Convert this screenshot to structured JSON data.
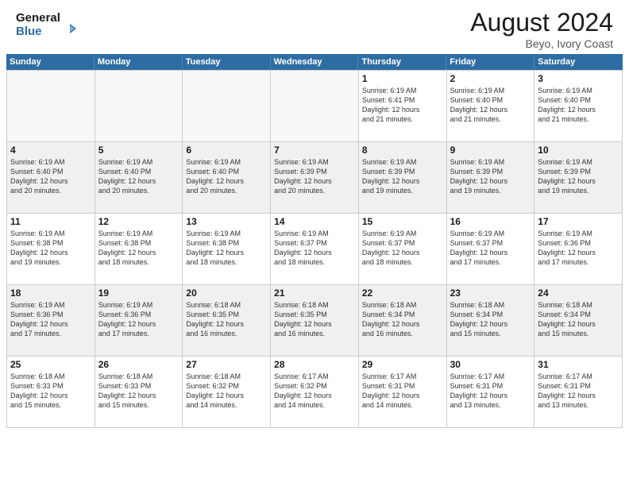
{
  "header": {
    "logo_line1": "General",
    "logo_line2": "Blue",
    "month_title": "August 2024",
    "location": "Beyo, Ivory Coast"
  },
  "days_of_week": [
    "Sunday",
    "Monday",
    "Tuesday",
    "Wednesday",
    "Thursday",
    "Friday",
    "Saturday"
  ],
  "weeks": [
    {
      "shaded": false,
      "cells": [
        {
          "day": "",
          "empty": true,
          "lines": []
        },
        {
          "day": "",
          "empty": true,
          "lines": []
        },
        {
          "day": "",
          "empty": true,
          "lines": []
        },
        {
          "day": "",
          "empty": true,
          "lines": []
        },
        {
          "day": "1",
          "empty": false,
          "lines": [
            "Sunrise: 6:19 AM",
            "Sunset: 6:41 PM",
            "Daylight: 12 hours",
            "and 21 minutes."
          ]
        },
        {
          "day": "2",
          "empty": false,
          "lines": [
            "Sunrise: 6:19 AM",
            "Sunset: 6:40 PM",
            "Daylight: 12 hours",
            "and 21 minutes."
          ]
        },
        {
          "day": "3",
          "empty": false,
          "lines": [
            "Sunrise: 6:19 AM",
            "Sunset: 6:40 PM",
            "Daylight: 12 hours",
            "and 21 minutes."
          ]
        }
      ]
    },
    {
      "shaded": true,
      "cells": [
        {
          "day": "4",
          "empty": false,
          "lines": [
            "Sunrise: 6:19 AM",
            "Sunset: 6:40 PM",
            "Daylight: 12 hours",
            "and 20 minutes."
          ]
        },
        {
          "day": "5",
          "empty": false,
          "lines": [
            "Sunrise: 6:19 AM",
            "Sunset: 6:40 PM",
            "Daylight: 12 hours",
            "and 20 minutes."
          ]
        },
        {
          "day": "6",
          "empty": false,
          "lines": [
            "Sunrise: 6:19 AM",
            "Sunset: 6:40 PM",
            "Daylight: 12 hours",
            "and 20 minutes."
          ]
        },
        {
          "day": "7",
          "empty": false,
          "lines": [
            "Sunrise: 6:19 AM",
            "Sunset: 6:39 PM",
            "Daylight: 12 hours",
            "and 20 minutes."
          ]
        },
        {
          "day": "8",
          "empty": false,
          "lines": [
            "Sunrise: 6:19 AM",
            "Sunset: 6:39 PM",
            "Daylight: 12 hours",
            "and 19 minutes."
          ]
        },
        {
          "day": "9",
          "empty": false,
          "lines": [
            "Sunrise: 6:19 AM",
            "Sunset: 6:39 PM",
            "Daylight: 12 hours",
            "and 19 minutes."
          ]
        },
        {
          "day": "10",
          "empty": false,
          "lines": [
            "Sunrise: 6:19 AM",
            "Sunset: 6:39 PM",
            "Daylight: 12 hours",
            "and 19 minutes."
          ]
        }
      ]
    },
    {
      "shaded": false,
      "cells": [
        {
          "day": "11",
          "empty": false,
          "lines": [
            "Sunrise: 6:19 AM",
            "Sunset: 6:38 PM",
            "Daylight: 12 hours",
            "and 19 minutes."
          ]
        },
        {
          "day": "12",
          "empty": false,
          "lines": [
            "Sunrise: 6:19 AM",
            "Sunset: 6:38 PM",
            "Daylight: 12 hours",
            "and 18 minutes."
          ]
        },
        {
          "day": "13",
          "empty": false,
          "lines": [
            "Sunrise: 6:19 AM",
            "Sunset: 6:38 PM",
            "Daylight: 12 hours",
            "and 18 minutes."
          ]
        },
        {
          "day": "14",
          "empty": false,
          "lines": [
            "Sunrise: 6:19 AM",
            "Sunset: 6:37 PM",
            "Daylight: 12 hours",
            "and 18 minutes."
          ]
        },
        {
          "day": "15",
          "empty": false,
          "lines": [
            "Sunrise: 6:19 AM",
            "Sunset: 6:37 PM",
            "Daylight: 12 hours",
            "and 18 minutes."
          ]
        },
        {
          "day": "16",
          "empty": false,
          "lines": [
            "Sunrise: 6:19 AM",
            "Sunset: 6:37 PM",
            "Daylight: 12 hours",
            "and 17 minutes."
          ]
        },
        {
          "day": "17",
          "empty": false,
          "lines": [
            "Sunrise: 6:19 AM",
            "Sunset: 6:36 PM",
            "Daylight: 12 hours",
            "and 17 minutes."
          ]
        }
      ]
    },
    {
      "shaded": true,
      "cells": [
        {
          "day": "18",
          "empty": false,
          "lines": [
            "Sunrise: 6:19 AM",
            "Sunset: 6:36 PM",
            "Daylight: 12 hours",
            "and 17 minutes."
          ]
        },
        {
          "day": "19",
          "empty": false,
          "lines": [
            "Sunrise: 6:19 AM",
            "Sunset: 6:36 PM",
            "Daylight: 12 hours",
            "and 17 minutes."
          ]
        },
        {
          "day": "20",
          "empty": false,
          "lines": [
            "Sunrise: 6:18 AM",
            "Sunset: 6:35 PM",
            "Daylight: 12 hours",
            "and 16 minutes."
          ]
        },
        {
          "day": "21",
          "empty": false,
          "lines": [
            "Sunrise: 6:18 AM",
            "Sunset: 6:35 PM",
            "Daylight: 12 hours",
            "and 16 minutes."
          ]
        },
        {
          "day": "22",
          "empty": false,
          "lines": [
            "Sunrise: 6:18 AM",
            "Sunset: 6:34 PM",
            "Daylight: 12 hours",
            "and 16 minutes."
          ]
        },
        {
          "day": "23",
          "empty": false,
          "lines": [
            "Sunrise: 6:18 AM",
            "Sunset: 6:34 PM",
            "Daylight: 12 hours",
            "and 15 minutes."
          ]
        },
        {
          "day": "24",
          "empty": false,
          "lines": [
            "Sunrise: 6:18 AM",
            "Sunset: 6:34 PM",
            "Daylight: 12 hours",
            "and 15 minutes."
          ]
        }
      ]
    },
    {
      "shaded": false,
      "cells": [
        {
          "day": "25",
          "empty": false,
          "lines": [
            "Sunrise: 6:18 AM",
            "Sunset: 6:33 PM",
            "Daylight: 12 hours",
            "and 15 minutes."
          ]
        },
        {
          "day": "26",
          "empty": false,
          "lines": [
            "Sunrise: 6:18 AM",
            "Sunset: 6:33 PM",
            "Daylight: 12 hours",
            "and 15 minutes."
          ]
        },
        {
          "day": "27",
          "empty": false,
          "lines": [
            "Sunrise: 6:18 AM",
            "Sunset: 6:32 PM",
            "Daylight: 12 hours",
            "and 14 minutes."
          ]
        },
        {
          "day": "28",
          "empty": false,
          "lines": [
            "Sunrise: 6:17 AM",
            "Sunset: 6:32 PM",
            "Daylight: 12 hours",
            "and 14 minutes."
          ]
        },
        {
          "day": "29",
          "empty": false,
          "lines": [
            "Sunrise: 6:17 AM",
            "Sunset: 6:31 PM",
            "Daylight: 12 hours",
            "and 14 minutes."
          ]
        },
        {
          "day": "30",
          "empty": false,
          "lines": [
            "Sunrise: 6:17 AM",
            "Sunset: 6:31 PM",
            "Daylight: 12 hours",
            "and 13 minutes."
          ]
        },
        {
          "day": "31",
          "empty": false,
          "lines": [
            "Sunrise: 6:17 AM",
            "Sunset: 6:31 PM",
            "Daylight: 12 hours",
            "and 13 minutes."
          ]
        }
      ]
    }
  ]
}
